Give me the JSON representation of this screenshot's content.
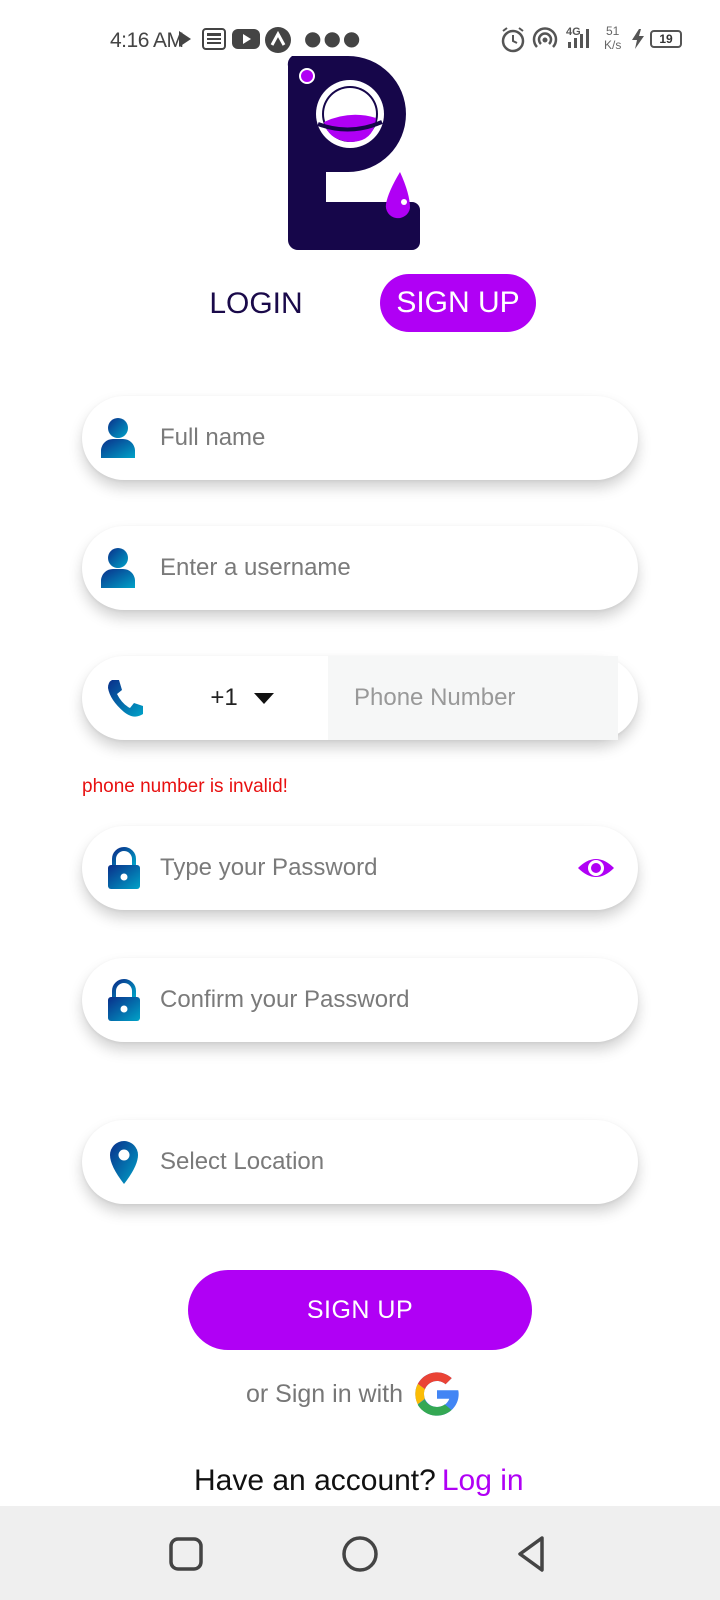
{
  "status_bar": {
    "time": "4:16 AM",
    "net_speed": "51",
    "net_unit": "K/s",
    "network": "4G",
    "battery": "19"
  },
  "tabs": {
    "login": "LOGIN",
    "signup": "SIGN UP"
  },
  "form": {
    "full_name_placeholder": "Full name",
    "username_placeholder": "Enter a  username",
    "country_code": "+1",
    "phone_placeholder": "Phone Number",
    "phone_error": "phone number is invalid!",
    "password_placeholder": "Type your Password",
    "confirm_password_placeholder": "Confirm your Password",
    "location_placeholder": "Select Location"
  },
  "actions": {
    "submit_label": "SIGN UP",
    "alt_signin_label": "or Sign in with",
    "have_account_label": "Have an account?",
    "login_link": "Log in"
  },
  "colors": {
    "accent": "#b000f5",
    "brand_dark": "#1a0a4a",
    "error": "#e81010"
  },
  "icons": {
    "name_fields": "user-icon",
    "phone": "phone-icon",
    "password": "lock-icon",
    "password_toggle": "eye-icon",
    "location": "location-pin-icon",
    "google": "google-icon"
  }
}
